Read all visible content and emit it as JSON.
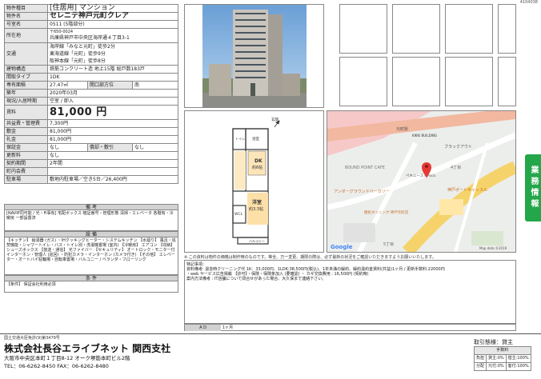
{
  "doc_id": "4104038",
  "property": {
    "type_label": "物件種目",
    "type_value": "[住居用] マンション",
    "name_label": "物件名",
    "name_value": "セレニテ神戸元町クレア",
    "room_label": "号室名",
    "room_value": "0511 (5階部分)",
    "address_label": "所在地",
    "postal": "〒650-0024",
    "address": "兵庫県神戸市中央区海岸通４丁目3-1",
    "transport_label": "交通",
    "transport": [
      "海岸線「みなと元町」徒歩2分",
      "東海道線「元町」徒歩9分",
      "阪神本線「元町」徒歩8分"
    ],
    "structure_label": "建物構造",
    "structure": "鉄筋コンクリート造 地上15階 総戸数183戸",
    "layout_label": "間取タイプ",
    "layout": "1DK",
    "area_label": "専有面積",
    "area": "27.47㎡",
    "opening_label": "開口部方位",
    "opening": "南",
    "built_label": "築年",
    "built": "2020年03月",
    "status_label": "現況/入居時期",
    "status": "空室 / 即入",
    "rent_label": "賃料",
    "rent": "81,000 円",
    "mgmt_label": "共益費・管理費",
    "mgmt": "7,300円",
    "deposit_label": "敷金",
    "deposit": "81,000円",
    "key_label": "礼金",
    "key": "81,000円",
    "guarantee_label": "保証金",
    "guarantee": "なし",
    "amort_label": "償却・敷引",
    "amort": "なし",
    "renewal_label": "更新料",
    "renewal": "なし",
    "contract_label": "契約期間",
    "contract": "2年間",
    "town_label": "町内会費",
    "town": "",
    "parking_label": "駐車場",
    "parking": "敷地内駐車場／空き5台／26,400円"
  },
  "remarks_section": {
    "title": "備 考",
    "body": "[NAVIP同可能 / 光・Fi事有] 宅配ボックス 暗証番号・管理形態 清掃・エレベータ 各階有・冷暖房 一部設置済"
  },
  "equipment_section": {
    "title": "設 備",
    "body": "【キッチン】 給湯器 (ガス) ・IHクッキングヒーター・システムキッチン 【水廻り】 風呂・追焚機能・シャワートイレ・バス・トイレ別・洗濯機置場 (室内) 【冷暖房】 エアコン 【収納】 シューズボックス 【放送・通信】 光ファイバー 【セキュリティ】 オートロック・モニター付インターホン・管理人 (巡回) ・防犯カメラ・インターホン (カメラ付き) 【その他】 エレベーター・オートバイ駐輪場・自転車置場・バルコニー / ベランダ・フローリング"
  },
  "conditions_section": {
    "title": "条 件",
    "body": "【条件】 保証会社利用必須"
  },
  "floorplan": {
    "dk": "DK",
    "dk_size": "約6帖",
    "washitsu": "洋室",
    "washitsu_size": "約3.3帖",
    "wic": "WCL",
    "toilet": "トイレ",
    "bath": "浴室",
    "genkan": "玄関",
    "balcony": "バルコニー"
  },
  "map": {
    "labels": [
      "元町駅",
      "KIKKI BUILDING",
      "ブラックアウト",
      "BOUND POINT CAFE",
      "ペキニーズトPoco",
      "アンダーグラウンドベーカリー",
      "健民ダイニング 神戸元町店",
      "神戸ポートキャッスル",
      "4丁目",
      "5丁目"
    ],
    "google": "Google",
    "attribution": "Map data ©2019"
  },
  "notice": "※ この資料は物件の価格は制作時のものです。等全、万一変更、期限の際は、必ず最新の状況をご確認いただきますようお願いいたします。",
  "remarks_box": {
    "header": "特記事項：",
    "line1": "資料備考: 退去時クリーニング代 1K：33,000円、1LDK:38,500円(税込)、1年未満の解約、解約違約金賃料(共益)1ヶ月 / 更新手数料:22000円",
    "line2": "・web サービス広告掲載 【許可】・保険・保険条加入 (要確認) ・ カギ交換費用 : 16,500円 (契約時)",
    "line3": "案内方法備考 : IT店舗について問合せがあった場合、大久保まで連絡下さい。"
  },
  "ad": {
    "label": "A D",
    "value": "1ヶ月"
  },
  "side_tab": "業務情報",
  "footer": {
    "license": "国土交通大臣免許(9)第3479号",
    "company": "株式会社長谷エライブネット 関西支社",
    "address": "大阪市中央区本町１丁目8-12 オーク堺筋本町ビル2階",
    "tel": "TEL：06-6262-8450  FAX：06-6262-8480",
    "deal": "取引態様：貸主",
    "fee_title": "手数料",
    "fee_rows": [
      {
        "label": "負担",
        "v1": "貸主:0%",
        "v2": "借主:100%"
      },
      {
        "label": "分配",
        "v1": "元付:0%",
        "v2": "客付:100%"
      }
    ]
  }
}
